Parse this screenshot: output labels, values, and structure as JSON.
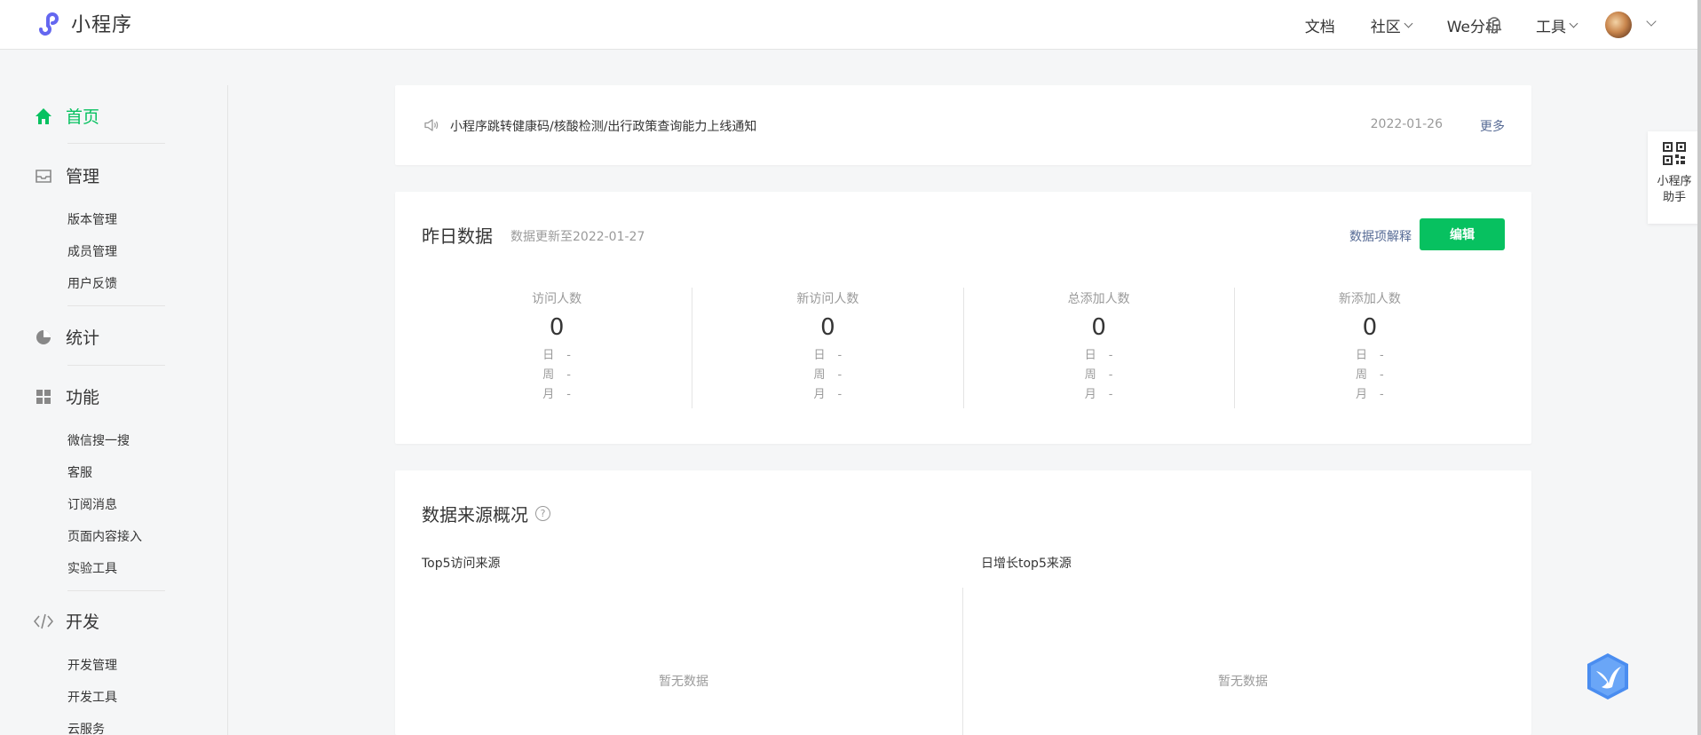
{
  "app": {
    "title": "小程序"
  },
  "nav": {
    "docs": "文档",
    "community": "社区",
    "we_analysis": "We分析",
    "tools": "工具"
  },
  "sidebar": {
    "home": "首页",
    "manage": "管理",
    "manage_items": [
      "版本管理",
      "成员管理",
      "用户反馈"
    ],
    "stats": "统计",
    "features": "功能",
    "feature_items": [
      "微信搜一搜",
      "客服",
      "订阅消息",
      "页面内容接入",
      "实验工具"
    ],
    "dev": "开发",
    "dev_items": [
      "开发管理",
      "开发工具",
      "云服务"
    ]
  },
  "notice": {
    "text": "小程序跳转健康码/核酸检测/出行政策查询能力上线通知",
    "date": "2022-01-26",
    "more": "更多"
  },
  "yesterday": {
    "title": "昨日数据",
    "updated": "数据更新至2022-01-27",
    "explain": "数据项解释",
    "edit": "编辑",
    "metrics": [
      {
        "label": "访问人数",
        "value": "0",
        "day": "日",
        "week": "周",
        "month": "月",
        "d": "-",
        "w": "-",
        "m": "-"
      },
      {
        "label": "新访问人数",
        "value": "0",
        "day": "日",
        "week": "周",
        "month": "月",
        "d": "-",
        "w": "-",
        "m": "-"
      },
      {
        "label": "总添加人数",
        "value": "0",
        "day": "日",
        "week": "周",
        "month": "月",
        "d": "-",
        "w": "-",
        "m": "-"
      },
      {
        "label": "新添加人数",
        "value": "0",
        "day": "日",
        "week": "周",
        "month": "月",
        "d": "-",
        "w": "-",
        "m": "-"
      }
    ]
  },
  "sources": {
    "title": "数据来源概况",
    "help": "?",
    "left_title": "Top5访问来源",
    "right_title": "日增长top5来源",
    "empty": "暂无数据"
  },
  "assistant": {
    "label_line1": "小程序",
    "label_line2": "助手"
  },
  "colors": {
    "brand_green": "#07c160",
    "link_blue": "#576b95",
    "logo_purple": "#6467f0"
  }
}
